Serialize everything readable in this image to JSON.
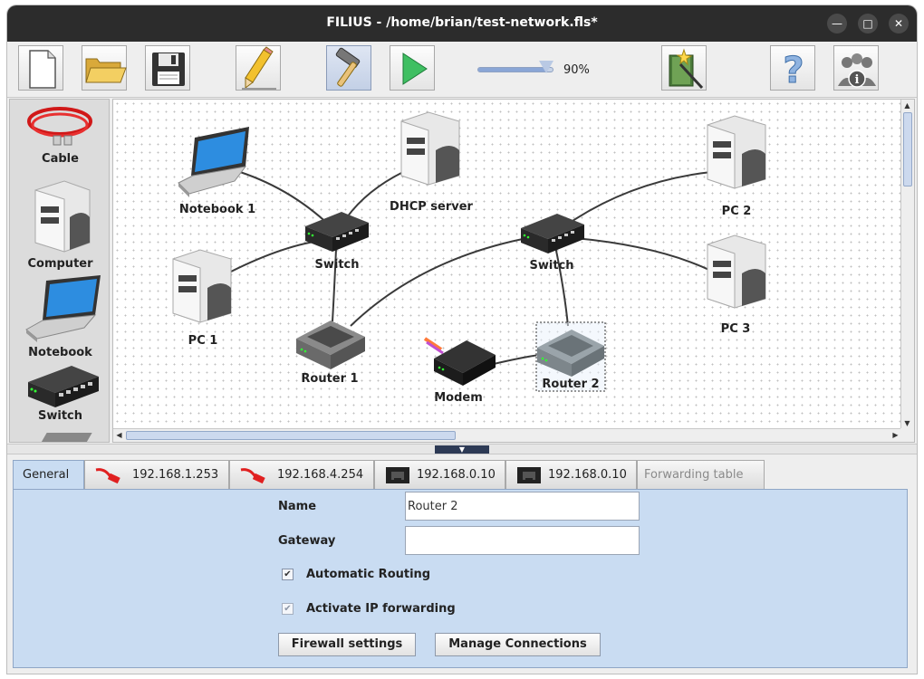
{
  "window": {
    "title": "FILIUS - /home/brian/test-network.fls*",
    "minimize_symbol": "—",
    "maximize_symbol": "□",
    "close_symbol": "✕"
  },
  "toolbar": {
    "buttons": [
      {
        "id": "new",
        "icon": "new-file-icon"
      },
      {
        "id": "open",
        "icon": "folder-open-icon"
      },
      {
        "id": "save",
        "icon": "floppy-disk-icon"
      },
      {
        "id": "design-mode",
        "icon": "pencil-icon"
      },
      {
        "id": "simulation-mode",
        "icon": "hammer-icon",
        "active": true
      },
      {
        "id": "run",
        "icon": "play-icon"
      },
      {
        "id": "wizard",
        "icon": "magic-book-icon"
      },
      {
        "id": "help",
        "icon": "question-mark-icon"
      },
      {
        "id": "about",
        "icon": "people-info-icon"
      }
    ],
    "zoom": {
      "value": 0.9,
      "label": "90%"
    }
  },
  "palette": {
    "items": [
      {
        "label": "Cable",
        "icon": "cable-icon"
      },
      {
        "label": "Computer",
        "icon": "computer-icon"
      },
      {
        "label": "Notebook",
        "icon": "notebook-icon"
      },
      {
        "label": "Switch",
        "icon": "switch-icon"
      }
    ]
  },
  "network": {
    "nodes": [
      {
        "id": "notebook1",
        "label": "Notebook 1",
        "type": "notebook"
      },
      {
        "id": "dhcp",
        "label": "DHCP server",
        "type": "computer"
      },
      {
        "id": "switch1",
        "label": "Switch",
        "type": "switch"
      },
      {
        "id": "pc1",
        "label": "PC 1",
        "type": "computer"
      },
      {
        "id": "router1",
        "label": "Router 1",
        "type": "router"
      },
      {
        "id": "switch2",
        "label": "Switch",
        "type": "switch"
      },
      {
        "id": "pc2",
        "label": "PC 2",
        "type": "computer"
      },
      {
        "id": "pc3",
        "label": "PC 3",
        "type": "computer"
      },
      {
        "id": "modem",
        "label": "Modem",
        "type": "modem"
      },
      {
        "id": "router2",
        "label": "Router 2",
        "type": "router",
        "selected": true
      }
    ],
    "links": [
      [
        "notebook1",
        "switch1"
      ],
      [
        "dhcp",
        "switch1"
      ],
      [
        "pc1",
        "switch1"
      ],
      [
        "switch1",
        "router1"
      ],
      [
        "router1",
        "switch2"
      ],
      [
        "switch2",
        "pc2"
      ],
      [
        "switch2",
        "pc3"
      ],
      [
        "switch2",
        "router2"
      ],
      [
        "modem",
        "router2"
      ]
    ]
  },
  "tabs": [
    {
      "label": "General",
      "active": true
    },
    {
      "label": "192.168.1.253",
      "icon": "red-cable-icon"
    },
    {
      "label": "192.168.4.254",
      "icon": "red-cable-icon"
    },
    {
      "label": "192.168.0.10",
      "icon": "network-port-icon"
    },
    {
      "label": "192.168.0.10",
      "icon": "network-port-icon"
    },
    {
      "label": "Forwarding table",
      "disabled": true
    }
  ],
  "general": {
    "name_label": "Name",
    "name_value": "Router 2",
    "gateway_label": "Gateway",
    "gateway_value": "",
    "automatic_routing": {
      "label": "Automatic Routing",
      "checked": true,
      "mark": "✔"
    },
    "ip_forwarding": {
      "label": "Activate IP forwarding",
      "checked": true,
      "disabled": true,
      "mark": "✔"
    },
    "firewall_button": "Firewall settings",
    "connections_button": "Manage Connections"
  }
}
